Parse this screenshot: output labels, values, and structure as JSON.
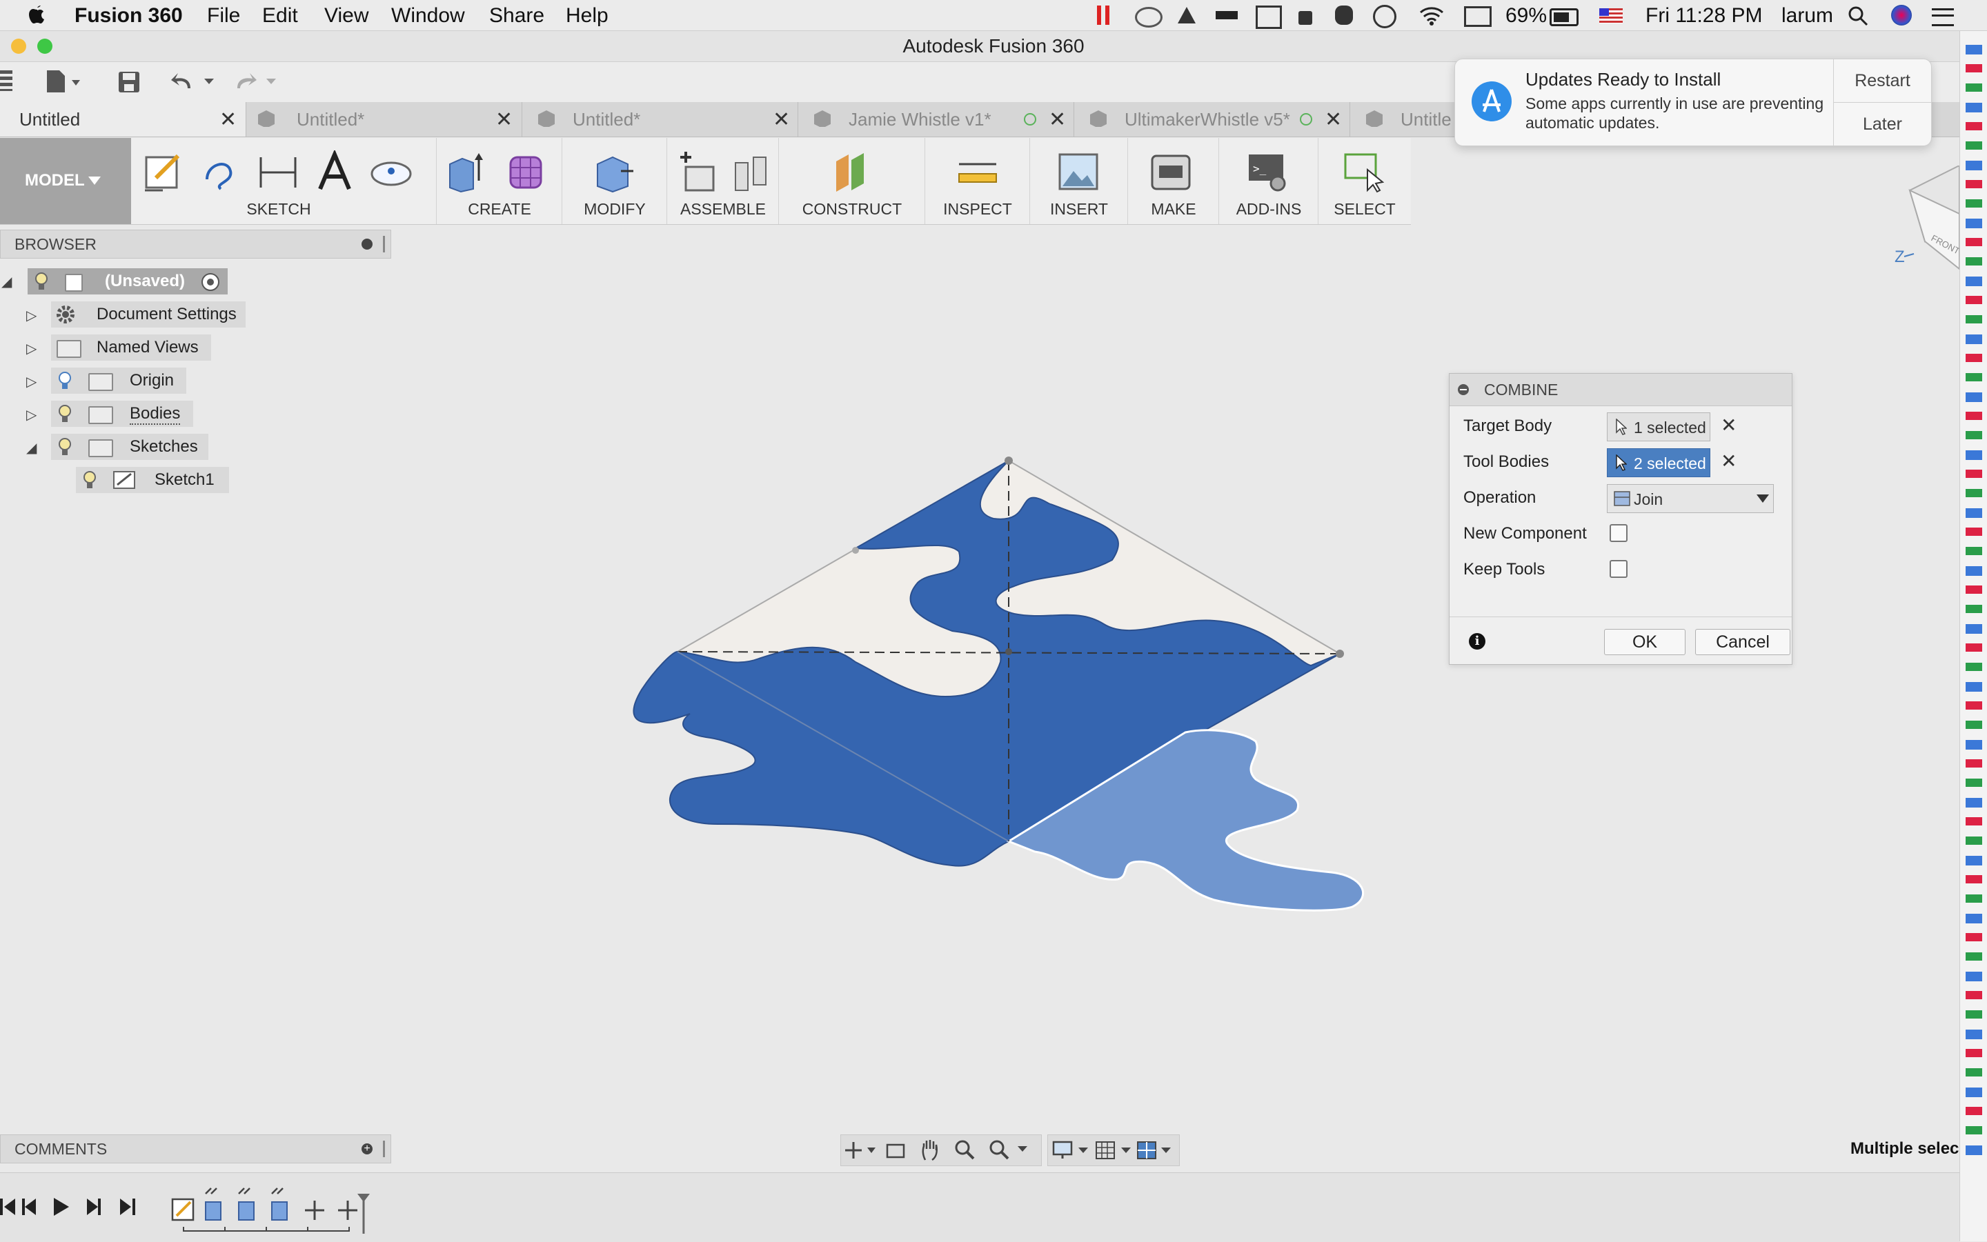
{
  "menubar": {
    "app_name": "Fusion 360",
    "items": [
      "File",
      "Edit",
      "View",
      "Window",
      "Share",
      "Help"
    ],
    "battery": "69%",
    "clock": "Fri 11:28 PM",
    "user": "larum"
  },
  "window": {
    "title": "Autodesk Fusion 360"
  },
  "tabs": [
    {
      "label": "Untitled",
      "active": true
    },
    {
      "label": "Untitled*",
      "active": false
    },
    {
      "label": "Untitled*",
      "active": false
    },
    {
      "label": "Jamie Whistle v1*",
      "active": false
    },
    {
      "label": "UltimakerWhistle v5*",
      "active": false
    },
    {
      "label": "Untitle",
      "active": false
    }
  ],
  "ribbon": {
    "workspace": "MODEL",
    "groups": [
      "SKETCH",
      "CREATE",
      "MODIFY",
      "ASSEMBLE",
      "CONSTRUCT",
      "INSPECT",
      "INSERT",
      "MAKE",
      "ADD-INS",
      "SELECT"
    ]
  },
  "browser": {
    "header": "BROWSER",
    "root": "(Unsaved)",
    "nodes": [
      "Document Settings",
      "Named Views",
      "Origin",
      "Bodies",
      "Sketches",
      "Sketch1"
    ]
  },
  "comments": {
    "header": "COMMENTS"
  },
  "notification": {
    "title": "Updates Ready to Install",
    "body": "Some apps currently in use are preventing automatic updates.",
    "restart_label": "Restart",
    "later_label": "Later",
    "accent": "#2f8ee8"
  },
  "combine": {
    "title": "COMBINE",
    "target_body_label": "Target Body",
    "target_body_value": "1 selected",
    "tool_bodies_label": "Tool Bodies",
    "tool_bodies_value": "2 selected",
    "operation_label": "Operation",
    "operation_value": "Join",
    "new_component_label": "New Component",
    "keep_tools_label": "Keep Tools",
    "ok_label": "OK",
    "cancel_label": "Cancel",
    "active_color": "#4a7fc1"
  },
  "viewcube": {
    "face": "FRONT",
    "axis": "Z"
  },
  "status_text": "Multiple selec",
  "colors": {
    "body_blue": "#3565b0",
    "body_light": "#7096cf",
    "sketch_face": "#f1eeea"
  }
}
